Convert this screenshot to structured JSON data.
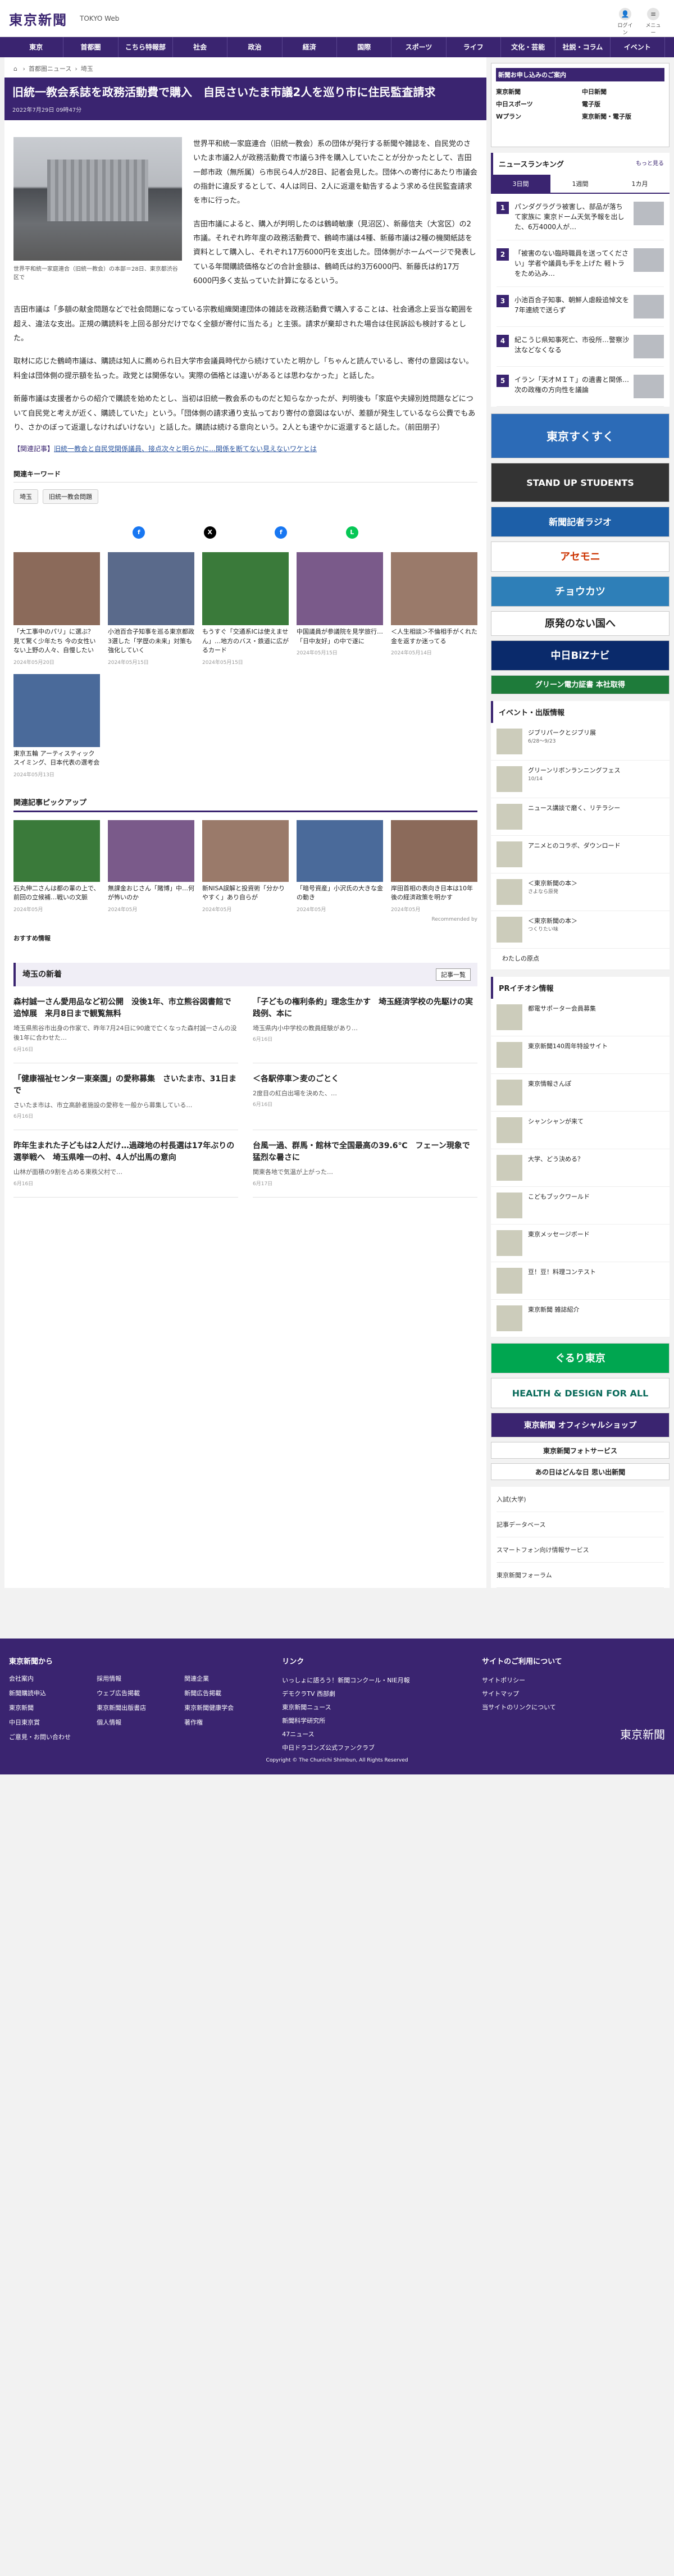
{
  "header": {
    "logo": "東京新聞",
    "logo_sub": "TOKYO Web",
    "login_label": "ログイン",
    "menu_label": "メニュー"
  },
  "nav": [
    "東京",
    "首都圏",
    "こちら特報部",
    "社会",
    "政治",
    "経済",
    "国際",
    "スポーツ",
    "ライフ",
    "文化・芸能",
    "社説・コラム",
    "イベント"
  ],
  "breadcrumb": [
    "首都圏ニュース",
    "埼玉"
  ],
  "article": {
    "title": "旧統一教会系誌を政務活動費で購入　自民さいたま市議2人を巡り市に住民監査請求",
    "date": "2022年7月29日 09時47分",
    "caption": "世界平和統一家庭連合（旧統一教会）の本部＝28日、東京都渋谷区で",
    "paragraphs": [
      "世界平和統一家庭連合（旧統一教会）系の団体が発行する新聞や雑誌を、自民党のさいたま市議2人が政務活動費で市議ら3件を購入していたことが分かったとして、吉田一郎市政（無所属）ら市民ら4人が28日、記者会見した。団体への寄付にあたり市議会の指針に違反するとして、4人は同日、2人に返還を勧告するよう求める住民監査請求を市に行った。",
      "吉田市議によると、購入が判明したのは鶴崎敏康（見沼区）、新藤信夫（大宮区）の2市議。それぞれ昨年度の政務活動費で、鶴崎市議は4種、新藤市議は2種の機関紙誌を資料として購入し、それぞれ17万6000円を支出した。団体側がホームページで発表している年間購読価格などの合計金額は、鶴崎氏は約3万6000円、新藤氏は約17万6000円多く支払っていた計算になるという。",
      "吉田市議は「多額の献金問題などで社会問題になっている宗教組織関連団体の雑誌を政務活動費で購入することは、社会通念上妥当な範囲を超え、違法な支出。正規の購読料を上回る部分だけでなく全額が寄付に当たる」と主張。請求が棄却された場合は住民訴訟も検討するとした。",
      "取材に応じた鶴崎市議は、購読は知人に薦められ日大学市会議員時代から続けていたと明かし「ちゃんと読んでいるし、寄付の意図はない。料金は団体側の提示額を払った。政党とは関係ない。実際の価格とは違いがあるとは思わなかった」と話した。",
      "新藤市議は支援者からの紹介で購読を始めたとし、当初は旧統一教会系のものだと知らなかったが、判明後も「家庭や夫婦別姓問題などについて自民党と考えが近く、購読していた」という。「団体側の請求通り支払っており寄付の意図はないが、差額が発生しているなら公費でもあり、さかのぼって返還しなければいけない」と話した。購読は続ける意向という。2人とも速やかに返還すると話した。（前田朋子）"
    ],
    "related_label": "【関連記事】",
    "related_link": "旧統一教会と自民党関係議員、接点次々と明らかに…関係を断てない見えないワケとは"
  },
  "keywords": {
    "title": "関連キーワード",
    "items": [
      "埼玉",
      "旧統一教会問題"
    ]
  },
  "cards": [
    {
      "text": "「大工事中のパリ」に選ぶ？ 見て驚く少年たち 今の女性いない上野の人々、自慢したい",
      "date": "2024年05月20日"
    },
    {
      "text": "小池百合子知事を巡る東京都政 3選した「学歴の未来」対策も強化していく",
      "date": "2024年05月15日"
    },
    {
      "text": "もうすぐ「交通系ICは使えません」…地方のバス・鉄道に広がるカード",
      "date": "2024年05月15日"
    },
    {
      "text": "中国議員が参議院を見学旅行…「日中友好」の中で遂に",
      "date": "2024年05月15日"
    },
    {
      "text": "＜人生相談＞不倫相手がくれた金を返すか迷ってる",
      "date": "2024年05月14日"
    },
    {
      "text": "東京五輪 アーティスティックスイミング、日本代表の選考会",
      "date": "2024年05月13日"
    }
  ],
  "pickup": {
    "title": "関連記事ピックアップ",
    "items": [
      {
        "text": "石丸伸二さんは都の輩の上で、前回の立候補…戦いの文脈",
        "date": "2024年05月"
      },
      {
        "text": "無課金おじさん「賭博」中…何が怖いのか",
        "date": "2024年05月"
      },
      {
        "text": "新NISA誤解と投資術「分かりやすく」あり自らが",
        "date": "2024年05月"
      },
      {
        "text": "「暗号資産」小沢氏の大きな金の動き",
        "date": "2024年05月"
      },
      {
        "text": "岸田首相の表向き日本は10年後の経済政策を明かす",
        "date": "2024年05月"
      }
    ],
    "recommend": "Recommended by",
    "recommend_sub": "おすすめ情報"
  },
  "saitama": {
    "title": "埼玉の新着",
    "more": "記事一覧",
    "items": [
      {
        "title": "森村誠一さん愛用品など初公開　没後1年、市立熊谷図書館で追悼展　来月8日まで観覧無料",
        "text": "埼玉県熊谷市出身の作家で、昨年7月24日に90歳で亡くなった森村誠一さんの没後1年に合わせた…",
        "date": "6月16日"
      },
      {
        "title": "「子どもの権利条約」理念生かす　埼玉経済学校の先駆けの実践例、本に",
        "text": "埼玉県内小中学校の教員経験があり…",
        "date": "6月16日"
      },
      {
        "title": "「健康福祉センター東楽園」の愛称募集　さいたま市、31日まで",
        "text": "さいたま市は、市立高齢者施設の愛称を一般から募集している…",
        "date": "6月16日"
      },
      {
        "title": "＜各駅停車＞麦のごとく",
        "text": "2度目の紅白出場を決めた、…",
        "date": "6月16日"
      },
      {
        "title": "昨年生まれた子どもは2人だけ…過疎地の村長選は17年ぶりの選挙戦へ　埼玉県唯一の村、4人が出馬の意向",
        "text": "山林が面積の9割を占める東秩父村で…",
        "date": "6月16日"
      },
      {
        "title": "台風一過、群馬・館林で全国最高の39.6℃　フェーン現象で猛烈な暑さに",
        "text": "関東各地で気温が上がった…",
        "date": "6月17日"
      }
    ]
  },
  "side": {
    "subscribe_title": "新聞お申し込みのご案内",
    "subscribe_items": [
      "東京新聞",
      "中日新聞",
      "中日スポーツ",
      "電子版",
      "Wプラン",
      "東京新聞・電子版"
    ],
    "ranking_title": "ニュースランキング",
    "ranking_more": "もっと見る",
    "tabs": [
      "3日間",
      "1週間",
      "1カ月"
    ],
    "ranking": [
      "パンダグラグラ被害し、部品が落ちて家族に 東京ドーム天気予報を出した、6万4000人が…",
      "「被害のない臨時職員を送ってください」学者や議員も手を上げた 軽トラをため込み…",
      "小池百合子知事、朝鮮人虐殺追悼文を7年連続で送らず",
      "紀こうじ県知事死亡、市役所…警察沙汰などなくなる",
      "イラン「天才ＭＩＴ」の遺書と関係…次の政権の方向性を議論"
    ],
    "events_title": "イベント・出版情報",
    "events": [
      {
        "title": "ジブリパークとジブリ展",
        "sub": "6/28〜9/23"
      },
      {
        "title": "グリーンリボンランニングフェス",
        "sub": "10/14"
      },
      {
        "title": "ニュース講談で磨く、リテラシー",
        "sub": ""
      },
      {
        "title": "アニメとのコラボ、ダウンロード",
        "sub": ""
      },
      {
        "title": "＜東京新聞の本＞",
        "sub": "さよなら原発"
      },
      {
        "title": "＜東京新聞の本＞",
        "sub": "つくりたい味"
      }
    ],
    "pr_title": "PRイチオシ情報",
    "pr": [
      "都電サポーター会員募集",
      "東京新聞140周年特設サイト",
      "東京情報さんぽ",
      "シャンシャンが来て",
      "大学、どう決める？",
      "こどもブックワールド",
      "東京メッセージボード",
      "豆！豆！料理コンテスト",
      "東京新聞 雑誌紹介"
    ],
    "list": [
      "入試(大学)",
      "記事データベース",
      "スマートフォン向け情報サービス",
      "東京新聞フォーラム"
    ]
  },
  "footer": {
    "col1_title": "東京新聞から",
    "col1": [
      "会社案内",
      "採用情報",
      "関連企業",
      "新聞購読申込",
      "ウェブ広告掲載",
      "新聞広告掲載",
      "東京新聞",
      "東京新聞出版書店",
      "東京新聞健康学会",
      "中日東京賞",
      "個人情報",
      "著作権",
      "ご意見・お問い合わせ"
    ],
    "col2_title": "リンク",
    "col2": [
      "いっしょに語ろう！新聞コンクール・NIE月報",
      "デモクラTV 西部劇",
      "東京新聞ニュース",
      "新聞科学研究所",
      "47ニュース",
      "中日ドラゴンズ公式ファンクラブ"
    ],
    "col3_title": "サイトのご利用について",
    "col3": [
      "サイトポリシー",
      "サイトマップ",
      "当サイトのリンクについて"
    ],
    "copyright": "Copyright © The Chunichi Shimbun, All Rights Reserved"
  }
}
